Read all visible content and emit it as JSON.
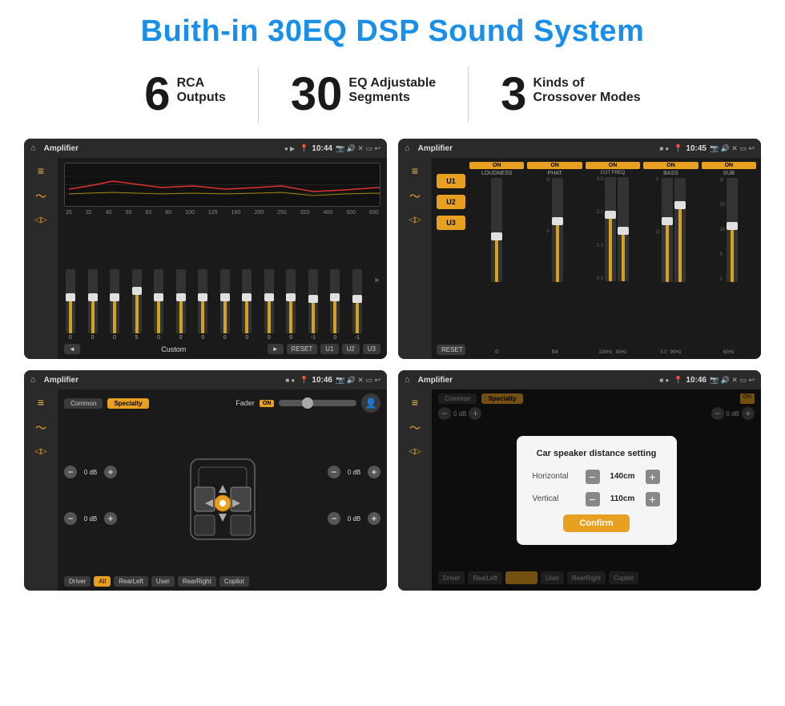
{
  "page": {
    "title": "Buith-in 30EQ DSP Sound System",
    "features": [
      {
        "number": "6",
        "line1": "RCA",
        "line2": "Outputs"
      },
      {
        "number": "30",
        "line1": "EQ Adjustable",
        "line2": "Segments"
      },
      {
        "number": "3",
        "line1": "Kinds of",
        "line2": "Crossover Modes"
      }
    ]
  },
  "screen1": {
    "title": "Amplifier",
    "time": "10:44",
    "freq_labels": [
      "25",
      "32",
      "40",
      "50",
      "63",
      "80",
      "100",
      "125",
      "160",
      "200",
      "250",
      "320",
      "400",
      "500",
      "630"
    ],
    "eq_values": [
      "0",
      "0",
      "0",
      "5",
      "0",
      "0",
      "0",
      "0",
      "0",
      "0",
      "0",
      "0",
      "0",
      "-1",
      "0",
      "-1"
    ],
    "preset_label": "Custom",
    "buttons": [
      "◄",
      "►",
      "RESET",
      "U1",
      "U2",
      "U3"
    ]
  },
  "screen2": {
    "title": "Amplifier",
    "time": "10:45",
    "presets": [
      "U1",
      "U2",
      "U3"
    ],
    "channels": [
      {
        "name": "LOUDNESS",
        "on": true
      },
      {
        "name": "PHAT",
        "on": true
      },
      {
        "name": "CUT FREQ",
        "on": true
      },
      {
        "name": "BASS",
        "on": true
      },
      {
        "name": "SUB",
        "on": true
      }
    ],
    "reset_label": "RESET"
  },
  "screen3": {
    "title": "Amplifier",
    "time": "10:46",
    "tabs": [
      "Common",
      "Specialty"
    ],
    "active_tab": "Specialty",
    "fader_label": "Fader",
    "fader_on": "ON",
    "volumes": [
      {
        "label": "0 dB",
        "position": "front-left"
      },
      {
        "label": "0 dB",
        "position": "front-right"
      },
      {
        "label": "0 dB",
        "position": "rear-left"
      },
      {
        "label": "0 dB",
        "position": "rear-right"
      }
    ],
    "bottom_buttons": [
      "Driver",
      "All",
      "User",
      "RearLeft",
      "RearRight",
      "Copilot"
    ]
  },
  "screen4": {
    "title": "Amplifier",
    "time": "10:46",
    "tabs": [
      "Common",
      "Specialty"
    ],
    "dialog": {
      "title": "Car speaker distance setting",
      "fields": [
        {
          "label": "Horizontal",
          "value": "140cm"
        },
        {
          "label": "Vertical",
          "value": "110cm"
        }
      ],
      "confirm_label": "Confirm"
    },
    "volumes": [
      {
        "label": "0 dB"
      },
      {
        "label": "0 dB"
      }
    ],
    "bottom_buttons": [
      "Driver",
      "RearLeft",
      "User",
      "RearRight",
      "Copilot"
    ]
  }
}
